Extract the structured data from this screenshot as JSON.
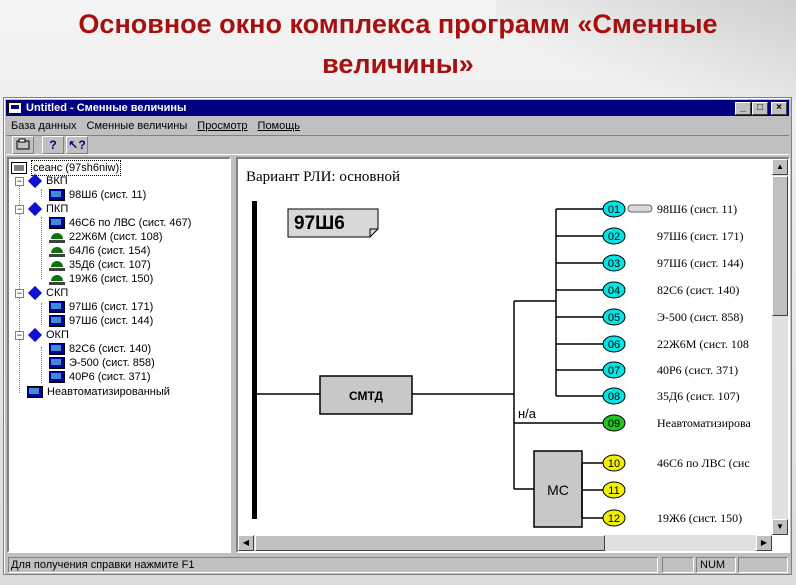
{
  "slide": {
    "title_line1": "Основное окно комплекса программ «Сменные",
    "title_line2": "величины»"
  },
  "window": {
    "title": "Untitled - Сменные величины",
    "controls": [
      "_",
      "□",
      "×"
    ]
  },
  "menu": [
    {
      "label": "База данных"
    },
    {
      "label": "Сменные величины"
    },
    {
      "label": "Просмотр"
    },
    {
      "label": "Помощь"
    }
  ],
  "toolbar": {
    "open_icon": "folder-open-icon",
    "help_icon": "help-icon",
    "context_help_icon": "context-help-icon",
    "help_glyph": "?",
    "context_help_glyph": "↖?"
  },
  "tree": {
    "root": "сеанс (97sh6niw)",
    "groups": [
      {
        "name": "ВКП",
        "items": [
          "98Ш6 (сист. 11)"
        ]
      },
      {
        "name": "ПКП",
        "items": [
          "46С6 по ЛВС (сист. 467)",
          "22Ж6М (сист. 108)",
          "64Л6 (сист. 154)",
          "35Д6 (сист. 107)",
          "19Ж6 (сист. 150)"
        ]
      },
      {
        "name": "СКП",
        "items": [
          "97Ш6 (сист. 171)",
          "97Ш6 (сист. 144)"
        ]
      },
      {
        "name": "ОКП",
        "items": [
          "82С6 (сист. 140)",
          "Э-500 (сист. 858)",
          "40Р6 (сист. 371)"
        ]
      }
    ],
    "extra": "Неавтоматизированный"
  },
  "diagram": {
    "heading": "Вариант РЛИ: основной",
    "station_tag": "97Ш6",
    "smtd_label": "СМТД",
    "ms_label": "МС",
    "na_label": "н/а",
    "nodes": [
      {
        "num": "01",
        "label": "98Ш6 (сист. 11)",
        "color": "#00e5e5"
      },
      {
        "num": "02",
        "label": "97Ш6 (сист. 171)",
        "color": "#00e5e5"
      },
      {
        "num": "03",
        "label": "97Ш6 (сист. 144)",
        "color": "#00e5e5"
      },
      {
        "num": "04",
        "label": "82С6 (сист. 140)",
        "color": "#00e5e5"
      },
      {
        "num": "05",
        "label": "Э-500 (сист. 858)",
        "color": "#00e5e5"
      },
      {
        "num": "06",
        "label": "22Ж6М (сист. 108",
        "color": "#00e5e5"
      },
      {
        "num": "07",
        "label": "40Р6 (сист. 371)",
        "color": "#00e5e5"
      },
      {
        "num": "08",
        "label": "35Д6 (сист. 107)",
        "color": "#00e5e5"
      },
      {
        "num": "09",
        "label": "Неавтоматизирова",
        "color": "#22c322"
      },
      {
        "num": "10",
        "label": "46С6 по ЛВС (сис",
        "color": "#f0f000"
      },
      {
        "num": "11",
        "label": "",
        "color": "#f0f000"
      },
      {
        "num": "12",
        "label": "19Ж6 (сист. 150)",
        "color": "#f0f000"
      }
    ]
  },
  "status": {
    "text": "Для получения справки нажмите F1",
    "num": "NUM"
  }
}
